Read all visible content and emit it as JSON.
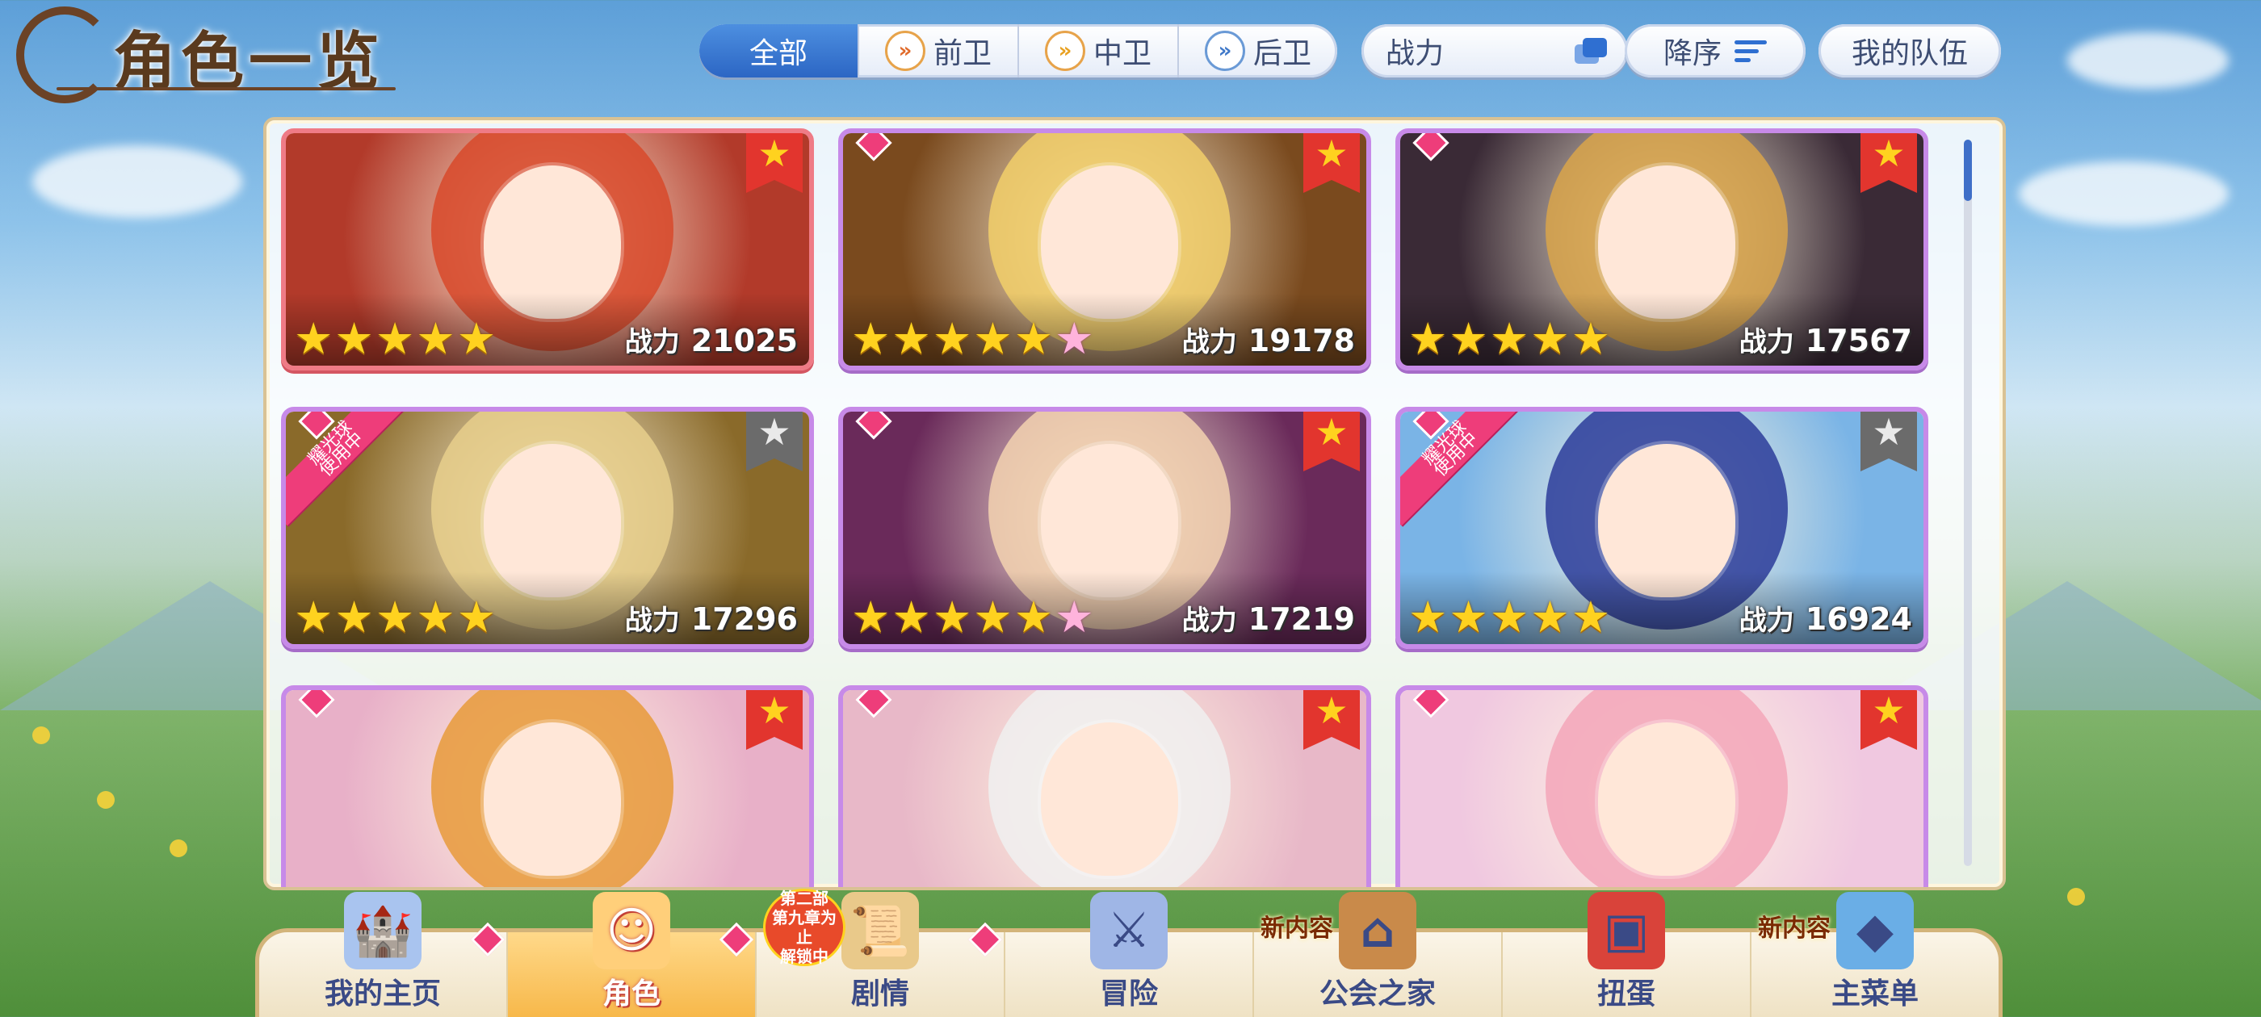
{
  "title": "角色一览",
  "filters": {
    "tabs": [
      {
        "label": "全部",
        "icon": "",
        "active": true
      },
      {
        "label": "前卫",
        "icon": "double-chevron-front-icon",
        "active": false
      },
      {
        "label": "中卫",
        "icon": "double-chevron-middle-icon",
        "active": false
      },
      {
        "label": "后卫",
        "icon": "double-chevron-back-icon",
        "active": false
      }
    ],
    "sort_by": "战力",
    "order": "降序",
    "my_team": "我的队伍"
  },
  "power_label": "战力",
  "ribbon_text": "耀光球\n使用中",
  "characters": [
    {
      "power": "21025",
      "stars": 5,
      "pink_star": false,
      "bookmark": "gold",
      "ribbon": false,
      "hair": "#d8492a",
      "bg": "#b23a2a",
      "frame": "red"
    },
    {
      "power": "19178",
      "stars": 5,
      "pink_star": true,
      "bookmark": "gold",
      "ribbon": false,
      "hair": "#f2cf6a",
      "bg": "#7a4a1e",
      "frame": "purple"
    },
    {
      "power": "17567",
      "stars": 5,
      "pink_star": false,
      "bookmark": "gold",
      "ribbon": false,
      "hair": "#d9a54a",
      "bg": "#3a2a36",
      "frame": "purple"
    },
    {
      "power": "17296",
      "stars": 5,
      "pink_star": false,
      "bookmark": "gray",
      "ribbon": true,
      "hair": "#e8cf8c",
      "bg": "#8a6a2a",
      "frame": "purple"
    },
    {
      "power": "17219",
      "stars": 5,
      "pink_star": true,
      "bookmark": "gold",
      "ribbon": false,
      "hair": "#f3d2b0",
      "bg": "#6a2a5a",
      "frame": "purple"
    },
    {
      "power": "16924",
      "stars": 5,
      "pink_star": false,
      "bookmark": "gray",
      "ribbon": true,
      "hair": "#2c3c9a",
      "bg": "#7ab4e6",
      "frame": "purple"
    },
    {
      "power": "",
      "stars": 0,
      "pink_star": false,
      "bookmark": "gold",
      "ribbon": false,
      "hair": "#e89a3a",
      "bg": "#e8b0c8",
      "frame": "purple"
    },
    {
      "power": "",
      "stars": 0,
      "pink_star": false,
      "bookmark": "gold",
      "ribbon": false,
      "hair": "#f0f0f0",
      "bg": "#e8b8c8",
      "frame": "purple"
    },
    {
      "power": "",
      "stars": 0,
      "pink_star": false,
      "bookmark": "gold",
      "ribbon": false,
      "hair": "#f3a6b8",
      "bg": "#f0c8e0",
      "frame": "purple"
    }
  ],
  "nav": [
    {
      "label": "我的主页",
      "icon": "castle-icon",
      "new": "",
      "badge": "",
      "dot": true,
      "active": false
    },
    {
      "label": "角色",
      "icon": "character-icon",
      "new": "",
      "badge": "",
      "dot": true,
      "active": true
    },
    {
      "label": "剧情",
      "icon": "scroll-icon",
      "new": "",
      "badge": "第二部\n第九章为止\n解锁中",
      "dot": true,
      "active": false
    },
    {
      "label": "冒险",
      "icon": "sword-flag-icon",
      "new": "",
      "badge": "",
      "dot": false,
      "active": false
    },
    {
      "label": "公会之家",
      "icon": "house-icon",
      "new": "新内容",
      "badge": "",
      "dot": false,
      "active": false
    },
    {
      "label": "扭蛋",
      "icon": "gacha-icon",
      "new": "",
      "badge": "",
      "dot": false,
      "active": false
    },
    {
      "label": "主菜单",
      "icon": "crystal-icon",
      "new": "新内容",
      "badge": "",
      "dot": false,
      "active": false
    }
  ],
  "colors": {
    "accent": "#2c66c4",
    "bookmark": "#e2352e",
    "diamond": "#ee3d7a",
    "star": "#ffd21f"
  }
}
